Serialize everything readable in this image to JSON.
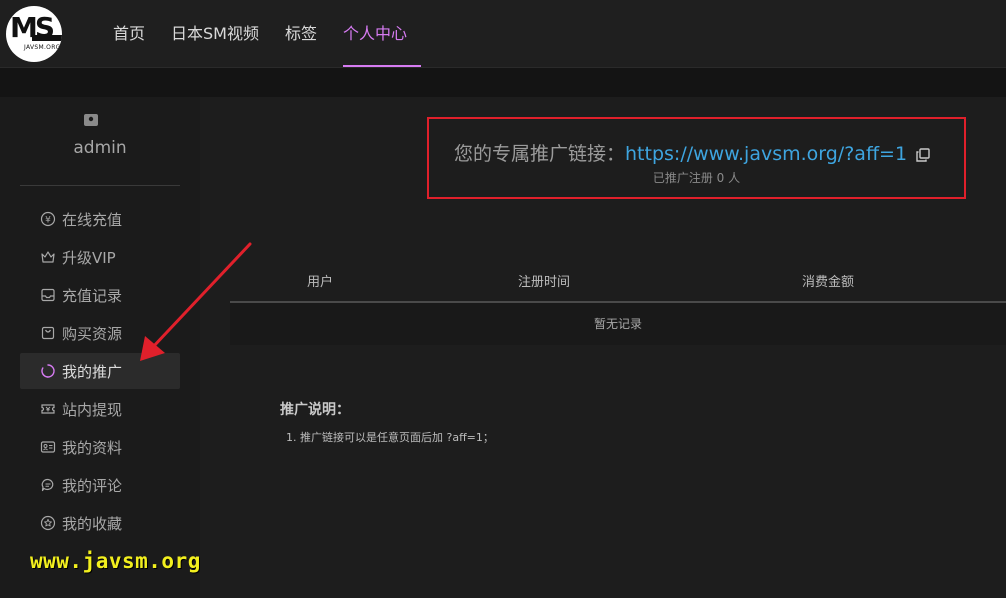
{
  "logo": {
    "text": "MS",
    "subtext": "JAVSM.ORG"
  },
  "nav": {
    "items": [
      {
        "label": "首页"
      },
      {
        "label": "日本SM视频"
      },
      {
        "label": "标签"
      },
      {
        "label": "个人中心",
        "active": true
      }
    ]
  },
  "sidebar": {
    "username": "admin",
    "items": [
      {
        "label": "在线充值",
        "icon": "yen-circle-icon"
      },
      {
        "label": "升级VIP",
        "icon": "crown-icon"
      },
      {
        "label": "充值记录",
        "icon": "inbox-icon"
      },
      {
        "label": "购买资源",
        "icon": "shopping-bag-icon"
      },
      {
        "label": "我的推广",
        "icon": "circle-sync-icon",
        "active": true
      },
      {
        "label": "站内提现",
        "icon": "withdraw-ticket-icon"
      },
      {
        "label": "我的资料",
        "icon": "id-card-icon"
      },
      {
        "label": "我的评论",
        "icon": "comment-icon"
      },
      {
        "label": "我的收藏",
        "icon": "star-circle-icon"
      }
    ]
  },
  "affiliate": {
    "label": "您的专属推广链接：",
    "link": "https://www.javsm.org/?aff=1",
    "count_text": "已推广注册 0 人"
  },
  "table": {
    "headers": [
      "用户",
      "注册时间",
      "消费金额"
    ],
    "empty_text": "暂无记录"
  },
  "notes": {
    "title": "推广说明：",
    "items": [
      "1. 推广链接可以是任意页面后加 ?aff=1；"
    ]
  },
  "watermark": "www.javsm.org",
  "colors": {
    "accent": "#d67bf2",
    "link": "#3ea5e0",
    "highlight_box": "#e0202b",
    "annotation_arrow": "#e0202b",
    "watermark": "#f2ef1e"
  }
}
